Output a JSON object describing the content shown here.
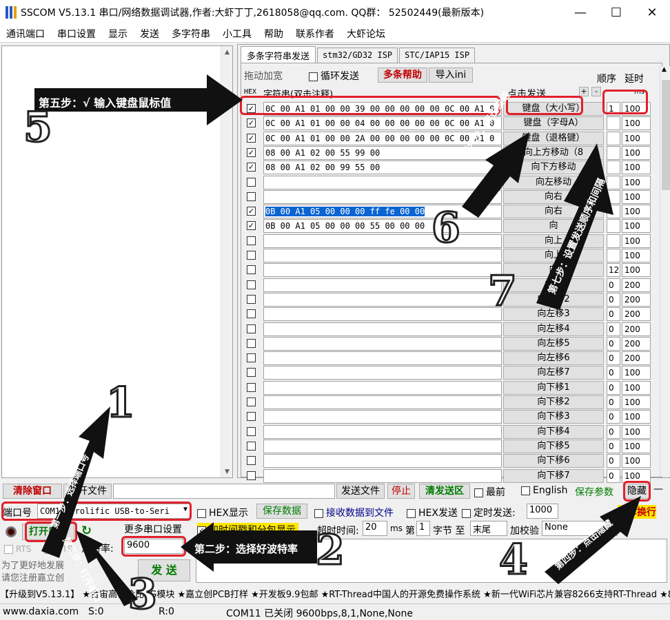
{
  "window": {
    "title": "SSCOM V5.13.1 串口/网络数据调试器,作者:大虾丁丁,2618058@qq.com. QQ群： 52502449(最新版本)"
  },
  "menu": [
    "通讯端口",
    "串口设置",
    "显示",
    "发送",
    "多字符串",
    "小工具",
    "帮助",
    "联系作者",
    "大虾论坛"
  ],
  "tabs": [
    "多条字符串发送",
    "stm32/GD32 ISP",
    "STC/IAP15 ISP"
  ],
  "toolbar": {
    "drag_label": "拖动加宽",
    "loop_label": "循环发送",
    "help_label": "多条帮助",
    "import_label": "导入ini",
    "order_label": "顺序",
    "delay_label": "延时",
    "hex_header": "HEX",
    "str_header": "字符串(双击注释)",
    "click_header": "点击发送",
    "plus": "+",
    "minus": "-",
    "ms": "ms"
  },
  "rows": [
    {
      "checked": true,
      "hex": "0C 00 A1 01 00 00 39 00 00 00 00 00 0C 00 A1 0",
      "label": "键盘（大小写）",
      "order": "1",
      "delay": "100"
    },
    {
      "checked": true,
      "hex": "0C 00 A1 01 00 00 04 00 00 00 00 00 0C 00 A1 0",
      "label": "键盘（字母A）",
      "order": "",
      "delay": "100"
    },
    {
      "checked": true,
      "hex": "0C 00 A1 01 00 00 2A 00 00 00 00 00 0C 00 A1 0",
      "label": "键盘（退格键）",
      "order": "",
      "delay": "100"
    },
    {
      "checked": true,
      "hex": "08 00 A1 02 00 55 99 00",
      "label": "向上方移动（8",
      "order": "",
      "delay": "100"
    },
    {
      "checked": true,
      "hex": "08 00 A1 02 00 99 55 00",
      "label": "向下方移动",
      "order": "",
      "delay": "100"
    },
    {
      "checked": false,
      "hex": "",
      "label": "向左移动",
      "order": "",
      "delay": "100"
    },
    {
      "checked": false,
      "hex": "",
      "label": "向右",
      "order": "",
      "delay": "100"
    },
    {
      "checked": true,
      "hex": "0B 00 A1 05 00 00 00 ff fe 00 00",
      "label": "向右",
      "order": "",
      "delay": "100",
      "selected": true
    },
    {
      "checked": true,
      "hex": "0B 00 A1 05 00 00 00 55 00 00 00",
      "label": "向",
      "order": "",
      "delay": "100"
    },
    {
      "checked": false,
      "hex": "",
      "label": "向上",
      "order": "",
      "delay": "100"
    },
    {
      "checked": false,
      "hex": "",
      "label": "向上",
      "order": "",
      "delay": "100"
    },
    {
      "checked": false,
      "hex": "",
      "label": "向",
      "order": "12",
      "delay": "100"
    },
    {
      "checked": false,
      "hex": "",
      "label": "向左",
      "order": "0",
      "delay": "200"
    },
    {
      "checked": false,
      "hex": "",
      "label": "向左移2",
      "order": "0",
      "delay": "200"
    },
    {
      "checked": false,
      "hex": "",
      "label": "向左移3",
      "order": "0",
      "delay": "200"
    },
    {
      "checked": false,
      "hex": "",
      "label": "向左移4",
      "order": "0",
      "delay": "200"
    },
    {
      "checked": false,
      "hex": "",
      "label": "向左移5",
      "order": "0",
      "delay": "200"
    },
    {
      "checked": false,
      "hex": "",
      "label": "向左移6",
      "order": "0",
      "delay": "200"
    },
    {
      "checked": false,
      "hex": "",
      "label": "向左移7",
      "order": "0",
      "delay": "100"
    },
    {
      "checked": false,
      "hex": "",
      "label": "向下移1",
      "order": "0",
      "delay": "100"
    },
    {
      "checked": false,
      "hex": "",
      "label": "向下移2",
      "order": "0",
      "delay": "100"
    },
    {
      "checked": false,
      "hex": "",
      "label": "向下移3",
      "order": "0",
      "delay": "100"
    },
    {
      "checked": false,
      "hex": "",
      "label": "向下移4",
      "order": "0",
      "delay": "100"
    },
    {
      "checked": false,
      "hex": "",
      "label": "向下移5",
      "order": "0",
      "delay": "100"
    },
    {
      "checked": false,
      "hex": "",
      "label": "向下移6",
      "order": "0",
      "delay": "100"
    },
    {
      "checked": false,
      "hex": "",
      "label": "向下移7",
      "order": "0",
      "delay": "100"
    }
  ],
  "bottom": {
    "clear_btn": "清除窗口",
    "open_file_btn": "打开文件",
    "send_file_btn": "发送文件",
    "stop_btn": "停止",
    "clear_send_btn": "清发送区",
    "topmost_label": "最前",
    "english_label": "English",
    "save_params": "保存参数",
    "hide_btn": "隐藏",
    "dash": "—",
    "port_label": "端口号",
    "port_value": "COM11 Prolific USB-to-Seri",
    "hex_show": "HEX显示",
    "save_data": "保存数据",
    "recv_to_file": "接收数据到文件",
    "hex_send": "HEX发送",
    "timed_send": "定时发送:",
    "timed_value": "1000",
    "crlf": "回车换行",
    "open_port_btn": "打开串口",
    "more_settings": "更多串口设置",
    "timestamp_label": "加时间戳和分包显示,",
    "timeout_label": "超时时间:",
    "timeout_value": "20",
    "ms": "ms",
    "nth": "第",
    "byte_num": "1",
    "byte_label": "字节 至",
    "end_value": "末尾",
    "checksum_label": "加校验",
    "checksum_value": "None",
    "rts": "RTS",
    "dtr": "DTR",
    "baud_label": "波特率:",
    "baud_value": "9600",
    "promo_line1": "为了更好地发展",
    "promo_line2": "请您注册嘉立创",
    "send_btn": "发 送"
  },
  "ticker": "【升级到V5.13.1】 ★合宙高性价比4G模块 ★嘉立创PCB打样 ★开发板9.9包邮 ★RT-Thread中国人的开源免费操作系统 ★新一代WiFi芯片兼容8266支持RT-Thread ★8KM远距离WiFi",
  "status": {
    "site": "www.daxia.com",
    "s": "S:0",
    "r": "R:0",
    "port": "COM11 已关闭  9600bps,8,1,None,None"
  },
  "annotations": {
    "step1": "第一步：选择端口号",
    "step2": "第二步：选择好波特率",
    "step3": "第三步：打开串口",
    "step4": "第四步：点击隐藏",
    "step5": "第五步：√ 输入键盘鼠标值",
    "step6": "第六步：点击发送",
    "step7": "第七步：设置发送顺序和间隔",
    "n1": "1",
    "n2": "2",
    "n3": "3",
    "n4": "4",
    "n5": "5",
    "n6": "6",
    "n7": "7"
  }
}
